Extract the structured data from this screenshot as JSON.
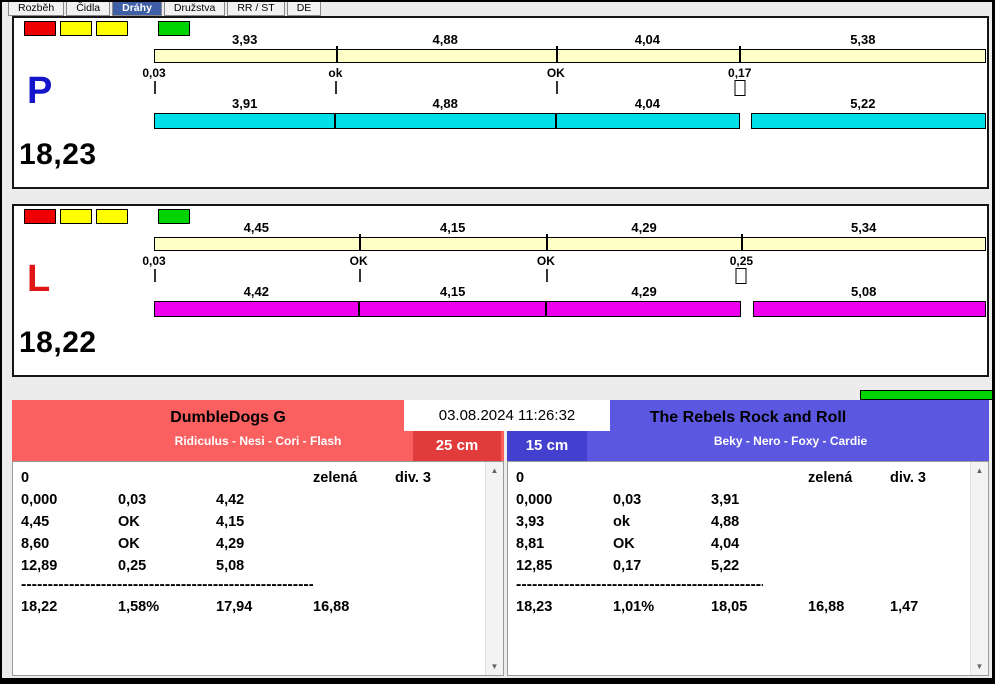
{
  "tabs": [
    "Rozběh",
    "Čidla",
    "Dráhy",
    "Družstva",
    "RR / ST",
    "DE"
  ],
  "icons": {
    "scroll_up": "▲",
    "scroll_down": "▼"
  },
  "colors": {
    "lane_p_bar": "#00dfe8",
    "lane_l_bar": "#ee00ee",
    "segment_bar": "#ffffc8",
    "light_red": "#ee0000",
    "light_yellow": "#ffff00",
    "light_green": "#00d400",
    "team_left_header": "#fa6060",
    "team_left_height": "#e23b3b",
    "team_right_header": "#5b57e0",
    "team_right_height": "#4340cf",
    "letter_p": "#1515cc",
    "letter_l": "#e01515"
  },
  "panels": [
    {
      "letter": "P",
      "total": "18,23",
      "top_values": [
        "3,93",
        "4,88",
        "4,04",
        "5,38"
      ],
      "mid_labels": [
        "0,03",
        "ok",
        "OK",
        "0,17"
      ],
      "bottom_values": [
        "3,91",
        "4,88",
        "4,04",
        "5,22"
      ]
    },
    {
      "letter": "L",
      "total": "18,22",
      "top_values": [
        "4,45",
        "4,15",
        "4,29",
        "5,34"
      ],
      "mid_labels": [
        "0,03",
        "OK",
        "OK",
        "0,25"
      ],
      "bottom_values": [
        "4,42",
        "4,15",
        "4,29",
        "5,08"
      ]
    }
  ],
  "bottom": {
    "datetime": "03.08.2024 11:26:32",
    "left": {
      "title": "DumbleDogs G",
      "dogs": "Ridiculus - Nesi - Cori - Flash",
      "height_label": "25 cm",
      "divider": "------------------------------------------------------------",
      "rows": [
        [
          "0",
          "",
          "",
          "zelená",
          "div. 3"
        ],
        [
          "0,000",
          "0,03",
          "4,42",
          "",
          ""
        ],
        [
          "4,45",
          "OK",
          "4,15",
          "",
          ""
        ],
        [
          "8,60",
          "OK",
          "4,29",
          "",
          ""
        ],
        [
          "12,89",
          "0,25",
          "5,08",
          "",
          ""
        ],
        [
          "18,22",
          "1,58%",
          "17,94",
          "16,88",
          ""
        ]
      ]
    },
    "right": {
      "title": "The Rebels Rock and Roll",
      "dogs": "Beky - Nero - Foxy - Cardie",
      "height_label": "15 cm",
      "divider": "------------------------------------------------------------",
      "rows": [
        [
          "0",
          "",
          "",
          "zelená",
          "div. 3"
        ],
        [
          "0,000",
          "0,03",
          "3,91",
          "",
          ""
        ],
        [
          "3,93",
          "ok",
          "4,88",
          "",
          ""
        ],
        [
          "8,81",
          "OK",
          "4,04",
          "",
          ""
        ],
        [
          "12,85",
          "0,17",
          "5,22",
          "",
          ""
        ],
        [
          "18,23",
          "1,01%",
          "18,05",
          "16,88",
          "1,47"
        ]
      ]
    }
  }
}
